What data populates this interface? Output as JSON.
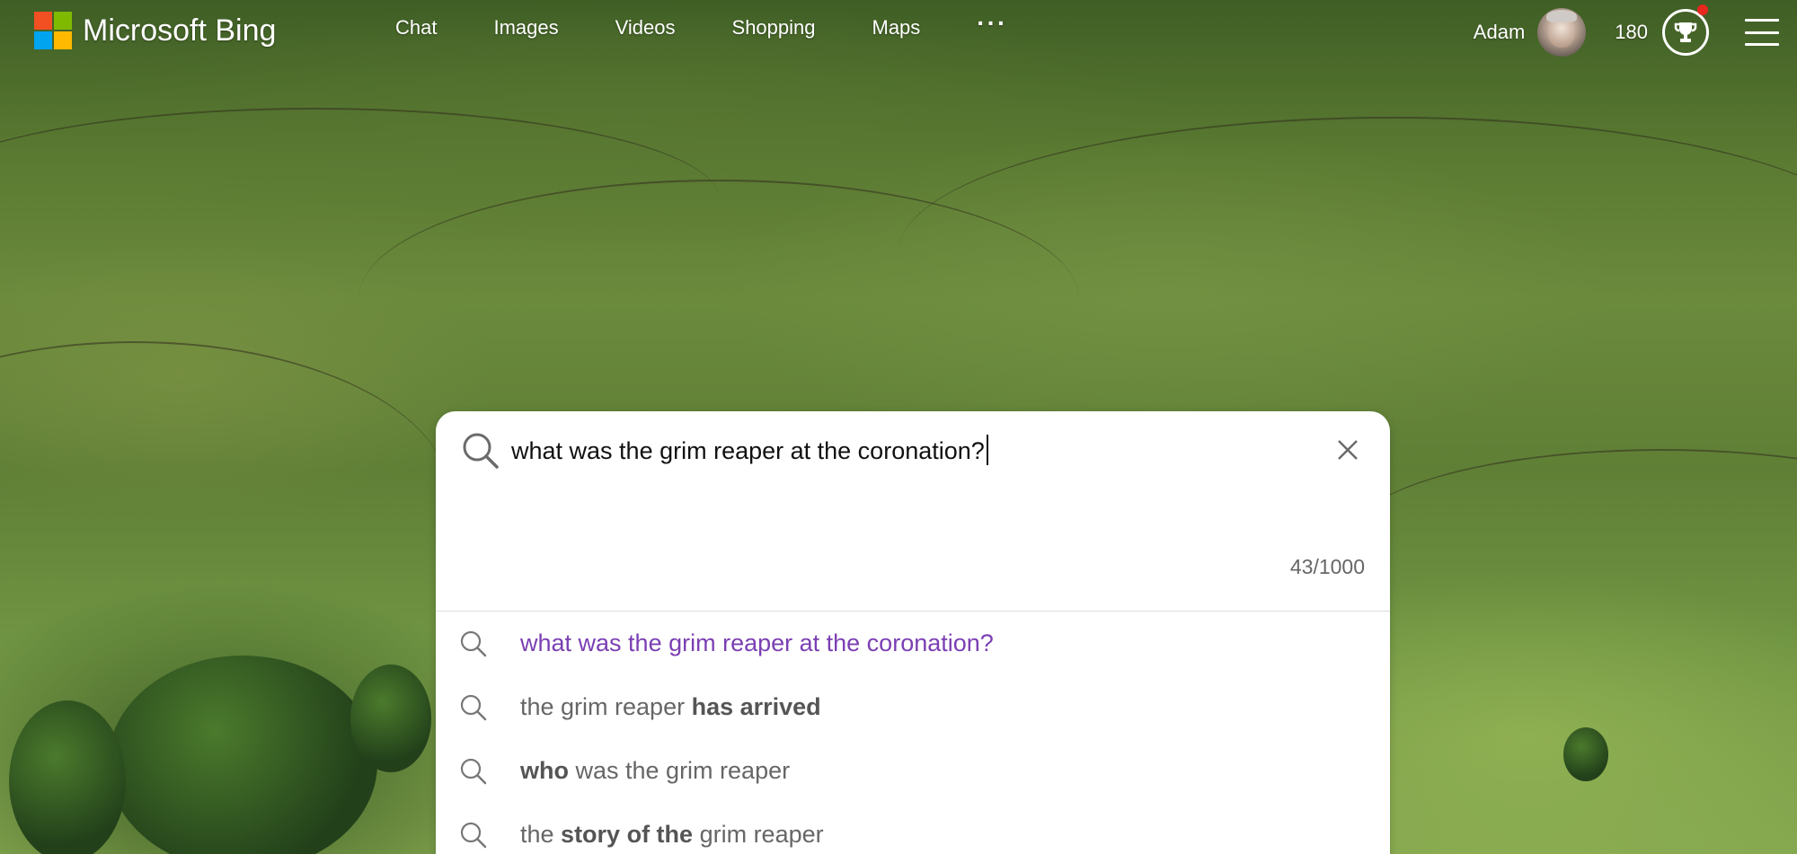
{
  "brand": {
    "name": "Microsoft Bing",
    "logo_colors": [
      "#f25022",
      "#7fba00",
      "#00a4ef",
      "#ffb900"
    ]
  },
  "nav": {
    "items": [
      {
        "label": "Chat"
      },
      {
        "label": "Images"
      },
      {
        "label": "Videos"
      },
      {
        "label": "Shopping"
      },
      {
        "label": "Maps"
      }
    ],
    "more_label": "···"
  },
  "user": {
    "name": "Adam",
    "points": "180",
    "rewards_icon": "trophy-icon",
    "notification_color": "#e8281f"
  },
  "search": {
    "query": "what was the grim reaper at the coronation?",
    "char_count": "43/1000",
    "clear_icon": "close-icon",
    "search_icon": "search-icon"
  },
  "suggestions": [
    {
      "parts": [
        {
          "text": "what was the grim reaper at the coronation?",
          "bold": false
        }
      ],
      "visited": true
    },
    {
      "parts": [
        {
          "text": "the grim reaper ",
          "bold": false
        },
        {
          "text": "has arrived",
          "bold": true
        }
      ],
      "visited": false
    },
    {
      "parts": [
        {
          "text": "who",
          "bold": true
        },
        {
          "text": " was the grim reaper",
          "bold": false
        }
      ],
      "visited": false
    },
    {
      "parts": [
        {
          "text": "the ",
          "bold": false
        },
        {
          "text": "story of the",
          "bold": true
        },
        {
          "text": " grim reaper",
          "bold": false
        }
      ],
      "visited": false
    }
  ],
  "colors": {
    "visited_suggestion": "#7b3fb3",
    "suggestion_text": "#666666"
  }
}
